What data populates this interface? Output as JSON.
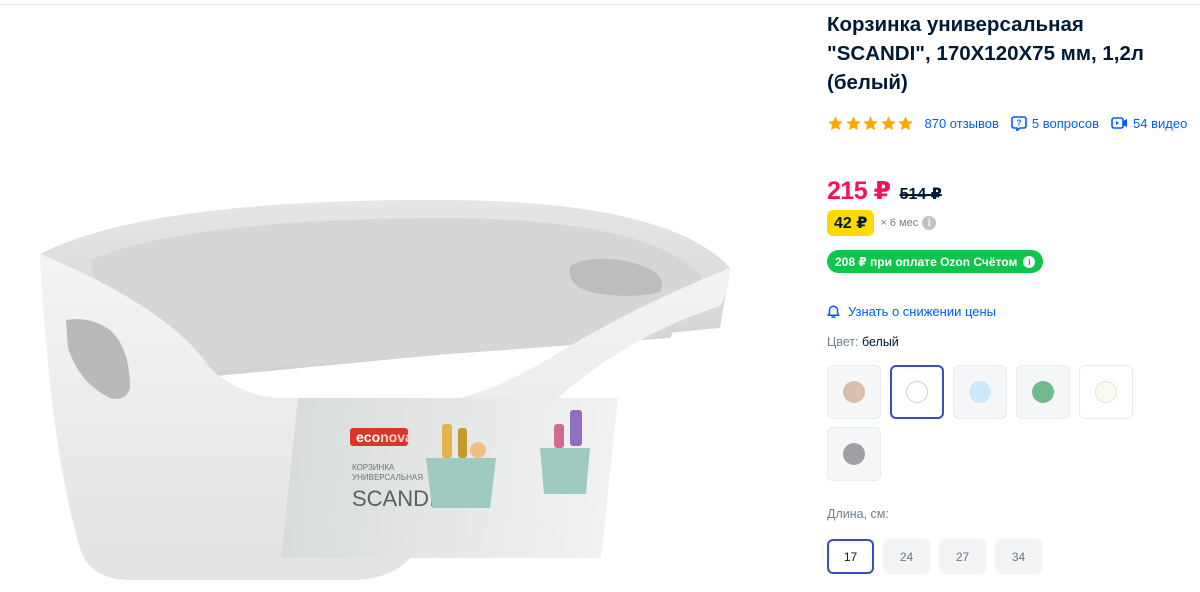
{
  "product": {
    "title": "Корзинка универсальная \"SCANDI\", 170X120X75 мм, 1,2л (белый)",
    "image_alt": "Белая пластиковая корзинка SCANDI с этикеткой econova",
    "label": {
      "brand_part1": "eco",
      "brand_part2": "nova",
      "line1": "КОРЗИНКА",
      "line2": "УНИВЕРСАЛЬНАЯ",
      "name": "SCANDI"
    }
  },
  "meta": {
    "rating": 5,
    "reviews": "870 отзывов",
    "questions": "5 вопросов",
    "videos": "54 видео"
  },
  "price": {
    "current": "215 ₽",
    "old": "514 ₽"
  },
  "installment": {
    "amount": "42 ₽",
    "terms": "× 6 мес"
  },
  "ozon_pay": {
    "text": "208 ₽ при оплате Ozon Счётом"
  },
  "notify": {
    "text": "Узнать о снижении цены"
  },
  "color": {
    "label": "Цвет:",
    "selected": "белый",
    "options": [
      {
        "name": "beige",
        "color": "#d8bfae"
      },
      {
        "name": "white",
        "color": "#ffffff"
      },
      {
        "name": "light-blue",
        "color": "#cfe6fb"
      },
      {
        "name": "green",
        "color": "#6fbb8e"
      },
      {
        "name": "ivory",
        "color": "#fbfaf0"
      },
      {
        "name": "gray",
        "color": "#9ea0a3"
      }
    ]
  },
  "length": {
    "label": "Длина, см:",
    "options": [
      "17",
      "24",
      "27",
      "34"
    ],
    "selected": "17"
  },
  "colors": {
    "price_red": "#f91155",
    "link_blue": "#005bff",
    "installment_yellow": "#ffd900",
    "ozon_green": "#10c44c",
    "selected_border": "#3b4cc9",
    "star": "#ffa800"
  }
}
